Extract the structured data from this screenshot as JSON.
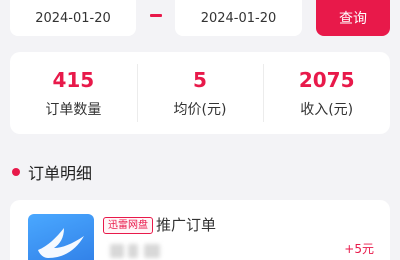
{
  "filter": {
    "start_date": "2024-01-20",
    "end_date": "2024-01-20",
    "query_label": "查询"
  },
  "stats": [
    {
      "value": "415",
      "label": "订单数量"
    },
    {
      "value": "5",
      "label": "均价(元)"
    },
    {
      "value": "2075",
      "label": "收入(元)"
    }
  ],
  "section": {
    "title": "订单明细"
  },
  "order": {
    "tag": "迅雷网盘",
    "type": "推广订单",
    "amount": "+5元"
  },
  "colors": {
    "accent": "#e8194a",
    "background": "#f3f3f6",
    "card": "#ffffff"
  }
}
